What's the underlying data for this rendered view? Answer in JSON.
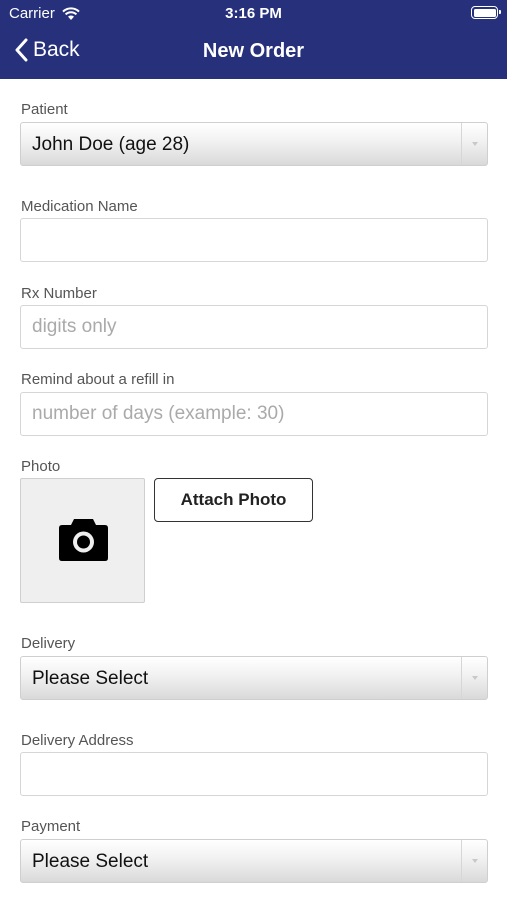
{
  "status_bar": {
    "carrier": "Carrier",
    "time": "3:16 PM",
    "wifi_icon": "wifi-icon",
    "battery_icon": "battery-icon"
  },
  "nav": {
    "back_label": "Back",
    "title": "New Order",
    "back_icon": "chevron-left-icon"
  },
  "colors": {
    "header_bg": "#26307b",
    "header_text": "#ffffff"
  },
  "form": {
    "patient": {
      "label": "Patient",
      "value": "John Doe (age 28)"
    },
    "medication": {
      "label": "Medication Name",
      "value": "",
      "placeholder": ""
    },
    "rx_number": {
      "label": "Rx Number",
      "placeholder": "digits only"
    },
    "refill": {
      "label": "Remind about a refill in",
      "placeholder": "number of days (example: 30)"
    },
    "photo": {
      "label": "Photo",
      "attach_label": "Attach Photo",
      "icon": "camera-icon"
    },
    "delivery": {
      "label": "Delivery",
      "value": "Please Select"
    },
    "delivery_address": {
      "label": "Delivery Address",
      "value": "",
      "placeholder": ""
    },
    "payment": {
      "label": "Payment",
      "value": "Please Select"
    }
  }
}
